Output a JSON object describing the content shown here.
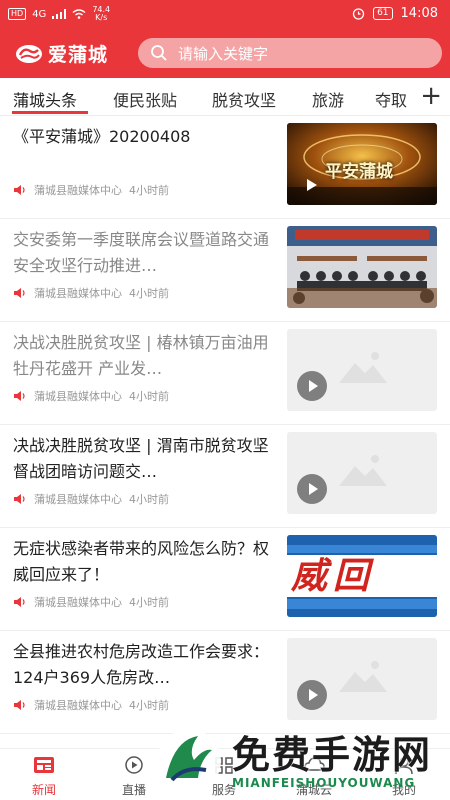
{
  "status": {
    "hd": "HD",
    "signal": "4G",
    "speed_value": "74.4",
    "speed_unit": "K/s",
    "battery": "61",
    "time": "14:08"
  },
  "header": {
    "app_name": "爱蒲城",
    "search_placeholder": "请输入关键字"
  },
  "tabs": [
    "蒲城头条",
    "便民张贴",
    "脱贫攻坚",
    "旅游",
    "夺取"
  ],
  "active_tab": 0,
  "news": [
    {
      "title": "《平安蒲城》20200408",
      "source": "蒲城县融媒体中心",
      "time": "4小时前",
      "read": false,
      "thumb": "video-ping-an"
    },
    {
      "title": "交安委第一季度联席会议暨道路交通安全攻坚行动推进…",
      "source": "蒲城县融媒体中心",
      "time": "4小时前",
      "read": true,
      "thumb": "meeting"
    },
    {
      "title": "决战决胜脱贫攻坚 | 椿林镇万亩油用牡丹花盛开 产业发…",
      "source": "蒲城县融媒体中心",
      "time": "4小时前",
      "read": true,
      "thumb": "placeholder-video"
    },
    {
      "title": "决战决胜脱贫攻坚 | 渭南市脱贫攻坚督战团暗访问题交…",
      "source": "蒲城县融媒体中心",
      "time": "4小时前",
      "read": false,
      "thumb": "placeholder-video"
    },
    {
      "title": "无症状感染者带来的风险怎么防？权威回应来了！",
      "source": "蒲城县融媒体中心",
      "time": "4小时前",
      "read": false,
      "thumb": "authority-banner"
    },
    {
      "title": "全县推进农村危房改造工作会要求：124户369人危房改…",
      "source": "蒲城县融媒体中心",
      "time": "4小时前",
      "read": false,
      "thumb": "placeholder-video"
    }
  ],
  "thumb_text": {
    "ping_an": "平安蒲城",
    "authority": "威回"
  },
  "bottom_nav": [
    {
      "label": "新闻",
      "icon": "news-icon",
      "active": true
    },
    {
      "label": "直播",
      "icon": "live-icon",
      "active": false
    },
    {
      "label": "服务",
      "icon": "service-icon",
      "active": false
    },
    {
      "label": "蒲城云",
      "icon": "cloud-icon",
      "active": false
    },
    {
      "label": "我的",
      "icon": "profile-icon",
      "active": false
    }
  ],
  "watermark": {
    "title": "免费手游网",
    "url": "MIANFEISHOUYOUWANG"
  },
  "colors": {
    "brand": "#e8363b",
    "text": "#222222",
    "read_text": "#888888",
    "meta": "#999999"
  }
}
